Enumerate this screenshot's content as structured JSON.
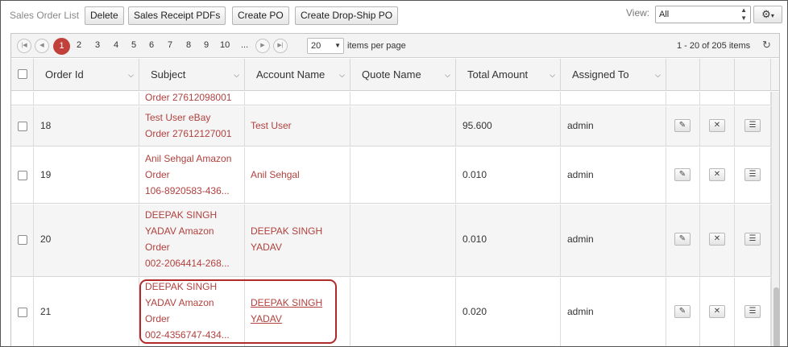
{
  "toolbar": {
    "title": "Sales Order List",
    "buttons": [
      "Delete",
      "Sales Receipt PDFs",
      "Create PO",
      "Create Drop-Ship PO"
    ],
    "view_label": "View:",
    "view_value": "All"
  },
  "pager": {
    "pages": [
      "1",
      "2",
      "3",
      "4",
      "5",
      "6",
      "7",
      "8",
      "9",
      "10",
      "..."
    ],
    "active_page": "1",
    "page_size": "20",
    "items_per_page_label": "items per page",
    "info": "1 - 20 of 205 items"
  },
  "columns": [
    "Order Id",
    "Subject",
    "Account Name",
    "Quote Name",
    "Total Amount",
    "Assigned To"
  ],
  "partial_row": {
    "subject_line": "Order 27612098001"
  },
  "rows": [
    {
      "id": "18",
      "subject": [
        "Test User eBay",
        "Order 27612127001"
      ],
      "account": [
        "Test User"
      ],
      "quote": "",
      "amount": "95.600",
      "assigned": "admin"
    },
    {
      "id": "19",
      "subject": [
        "Anil Sehgal Amazon",
        "Order",
        "106-8920583-436..."
      ],
      "account": [
        "Anil Sehgal"
      ],
      "quote": "",
      "amount": "0.010",
      "assigned": "admin"
    },
    {
      "id": "20",
      "subject": [
        "DEEPAK SINGH",
        "YADAV Amazon",
        "Order",
        "002-2064414-268..."
      ],
      "account": [
        "DEEPAK SINGH",
        "YADAV"
      ],
      "quote": "",
      "amount": "0.010",
      "assigned": "admin"
    },
    {
      "id": "21",
      "subject": [
        "DEEPAK SINGH",
        "YADAV Amazon",
        "Order",
        "002-4356747-434..."
      ],
      "account": [
        "DEEPAK SINGH",
        "YADAV"
      ],
      "quote": "",
      "amount": "0.020",
      "assigned": "admin"
    }
  ],
  "colors": {
    "link": "#b0413e",
    "active_page": "#c1413a",
    "highlight": "#b12a2a"
  }
}
